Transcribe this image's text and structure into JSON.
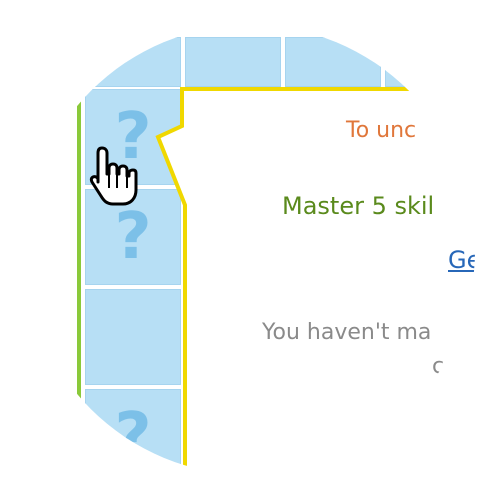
{
  "popup": {
    "heading": "To unc",
    "requirement": "Master 5 skil",
    "link": "Ge",
    "status_line1": "You haven't ma",
    "status_line2": "c"
  },
  "tiles": {
    "hidden_symbol": "?"
  },
  "colors": {
    "tile_fill": "#b7dff5",
    "question_mark": "#7cc0e8",
    "popup_border": "#f0d800",
    "board_outline": "#8ac93a",
    "heading_text": "#e0773b",
    "requirement_text": "#5a8a1c",
    "link_text": "#2767b8",
    "status_text": "#8a8a8a"
  },
  "cursor": {
    "icon": "hand-pointer-icon"
  }
}
